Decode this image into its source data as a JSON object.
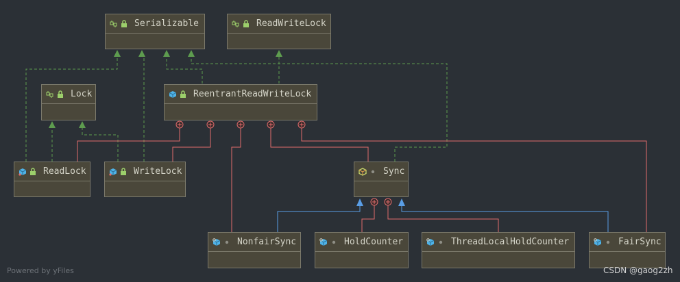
{
  "nodes": [
    {
      "id": "serializable",
      "label": "Serializable",
      "kind": "interface",
      "access": "lock"
    },
    {
      "id": "readwritelock",
      "label": "ReadWriteLock",
      "kind": "interface",
      "access": "lock"
    },
    {
      "id": "lock",
      "label": "Lock",
      "kind": "interface",
      "access": "lock"
    },
    {
      "id": "reentrant",
      "label": "ReentrantReadWriteLock",
      "kind": "class",
      "access": "lock"
    },
    {
      "id": "readlock",
      "label": "ReadLock",
      "kind": "inner-class",
      "access": "lock"
    },
    {
      "id": "writelock",
      "label": "WriteLock",
      "kind": "inner-class",
      "access": "lock"
    },
    {
      "id": "sync",
      "label": "Sync",
      "kind": "abstract-class",
      "access": "dot"
    },
    {
      "id": "nonfair",
      "label": "NonfairSync",
      "kind": "static-class",
      "access": "dot"
    },
    {
      "id": "holdcounter",
      "label": "HoldCounter",
      "kind": "static-class",
      "access": "dot"
    },
    {
      "id": "threadlocal",
      "label": "ThreadLocalHoldCounter",
      "kind": "static-class",
      "access": "dot"
    },
    {
      "id": "fairsync",
      "label": "FairSync",
      "kind": "static-class",
      "access": "dot"
    }
  ],
  "colors": {
    "background": "#2b3036",
    "node_fill": "#4a473a",
    "node_border": "#7c7a6c",
    "implements_edge": "#5e9c4f",
    "extends_edge": "#5a9ee6",
    "inner_edge": "#e06c6c",
    "text": "#d4d4c8"
  },
  "footer": {
    "powered_by": "Powered by yFiles",
    "watermark": "CSDN @gaog2zh"
  }
}
